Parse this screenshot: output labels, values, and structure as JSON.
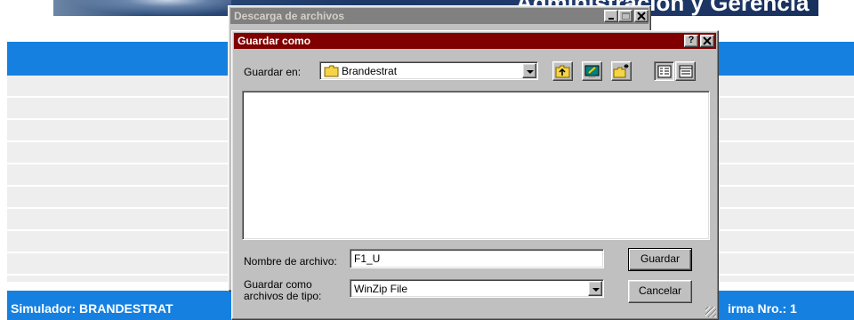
{
  "background": {
    "banner_title": "Administración y Gerencia",
    "footer_left": "Simulador: BRANDESTRAT",
    "footer_right": "irma Nro.: 1"
  },
  "download_window": {
    "title": "Descarga de archivos"
  },
  "save_dialog": {
    "title": "Guardar como",
    "help_label": "?",
    "close_label": "×",
    "save_in_label": "Guardar en:",
    "save_in_value": "Brandestrat",
    "file_name_label": "Nombre de archivo:",
    "file_name_value": "F1_U",
    "save_as_type_label_1": "Guardar como",
    "save_as_type_label_2": "archivos de tipo:",
    "save_as_type_value": "WinZip File",
    "save_button": "Guardar",
    "cancel_button": "Cancelar"
  },
  "colors": {
    "active_title": "#800000",
    "inactive_title": "#808080",
    "page_bar": "#1580e0"
  },
  "icons": [
    "folder-icon",
    "up-folder-icon",
    "desktop-icon",
    "new-folder-icon",
    "list-view-icon",
    "details-view-icon",
    "minimize-icon",
    "maximize-icon",
    "close-icon",
    "help-icon"
  ]
}
